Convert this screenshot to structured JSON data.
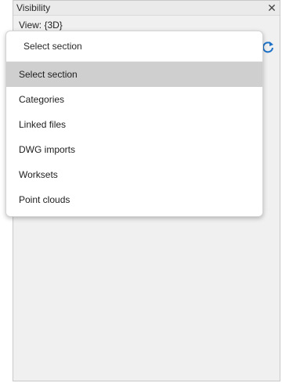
{
  "window": {
    "title": "Visibility",
    "close_glyph": "✕",
    "view_label": "View: {3D}"
  },
  "dropdown": {
    "current_value": "Select section",
    "options": [
      {
        "label": "Select section",
        "selected": true
      },
      {
        "label": "Categories",
        "selected": false
      },
      {
        "label": "Linked files",
        "selected": false
      },
      {
        "label": "DWG imports",
        "selected": false
      },
      {
        "label": "Worksets",
        "selected": false
      },
      {
        "label": "Point clouds",
        "selected": false
      }
    ]
  },
  "icons": {
    "refresh": "refresh-icon",
    "close": "close-icon"
  },
  "colors": {
    "accent": "#1e73c8",
    "selected_bg": "#cfcfcf",
    "panel_bg": "#f0f0f0"
  }
}
